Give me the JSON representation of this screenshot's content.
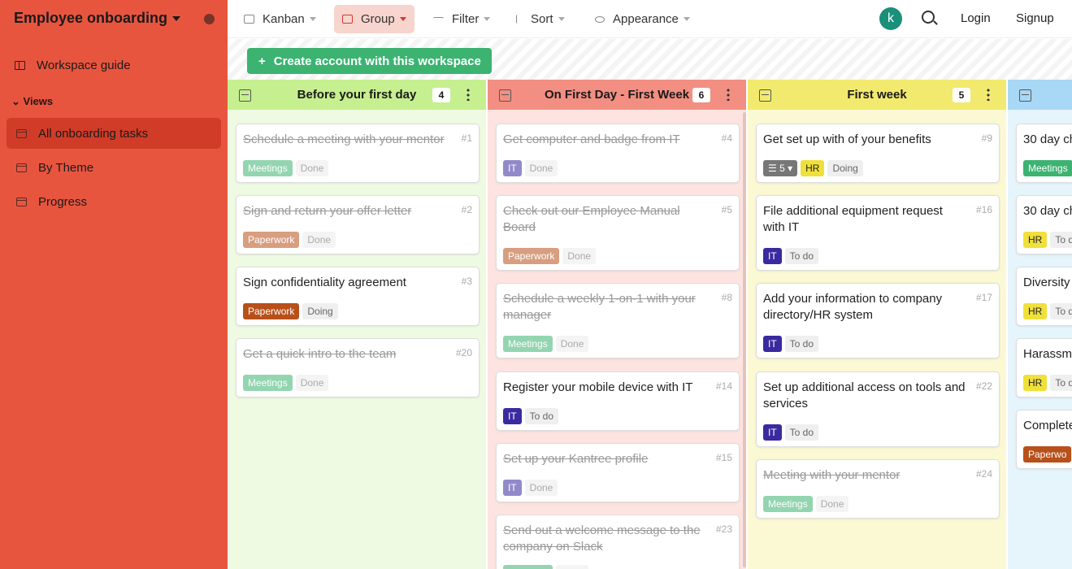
{
  "sidebar": {
    "workspace_title": "Employee onboarding",
    "guide_label": "Workspace guide",
    "views_label": "Views",
    "items": [
      {
        "label": "All onboarding tasks",
        "active": true
      },
      {
        "label": "By Theme",
        "active": false
      },
      {
        "label": "Progress",
        "active": false
      }
    ]
  },
  "toolbar": {
    "kanban": "Kanban",
    "group": "Group",
    "filter": "Filter",
    "sort": "Sort",
    "appearance": "Appearance",
    "avatar_letter": "k",
    "login": "Login",
    "signup": "Signup"
  },
  "banner": {
    "create_label": "Create account with this workspace"
  },
  "columns": [
    {
      "title": "Before your first day",
      "count": "4",
      "color": "#c6ef8f",
      "bg": "#eefbe2",
      "cards": [
        {
          "title": "Schedule a meeting with your mentor",
          "num": "#1",
          "done": true,
          "tag": "Meetings",
          "status": "Done"
        },
        {
          "title": "Sign and return your offer letter",
          "num": "#2",
          "done": true,
          "tag": "Paperwork",
          "status": "Done"
        },
        {
          "title": "Sign confidentiality agreement",
          "num": "#3",
          "done": false,
          "tag": "Paperwork",
          "status": "Doing"
        },
        {
          "title": "Get a quick intro to the team",
          "num": "#20",
          "done": true,
          "tag": "Meetings",
          "status": "Done"
        }
      ]
    },
    {
      "title": "On First Day - First Week",
      "count": "6",
      "color": "#f28f82",
      "bg": "#fde4e0",
      "cards": [
        {
          "title": "Get computer and badge from IT",
          "num": "#4",
          "done": true,
          "tag": "IT",
          "status": "Done"
        },
        {
          "title": "Check out our Employee Manual Board",
          "num": "#5",
          "done": true,
          "tag": "Paperwork",
          "status": "Done"
        },
        {
          "title": "Schedule a weekly 1-on-1 with your manager",
          "num": "#8",
          "done": true,
          "tag": "Meetings",
          "status": "Done"
        },
        {
          "title": "Register your mobile device with IT",
          "num": "#14",
          "done": false,
          "tag": "IT",
          "status": "To do"
        },
        {
          "title": "Set up your Kantree profile",
          "num": "#15",
          "done": true,
          "tag": "IT",
          "status": "Done"
        },
        {
          "title": "Send out a welcome message to the company on Slack",
          "num": "#23",
          "done": true,
          "tag": "Meetings",
          "status": "Done"
        }
      ]
    },
    {
      "title": "First week",
      "count": "5",
      "color": "#f2ea6e",
      "bg": "#fbf8d4",
      "cards": [
        {
          "title": "Get set up with of your benefits",
          "num": "#9",
          "done": false,
          "sub": "5",
          "tag": "HR",
          "status": "Doing"
        },
        {
          "title": "File additional equipment request with IT",
          "num": "#16",
          "done": false,
          "tag": "IT",
          "status": "To do"
        },
        {
          "title": "Add your information to company directory/HR system",
          "num": "#17",
          "done": false,
          "tag": "IT",
          "status": "To do"
        },
        {
          "title": "Set up additional access on tools and services",
          "num": "#22",
          "done": false,
          "tag": "IT",
          "status": "To do"
        },
        {
          "title": "Meeting with your mentor",
          "num": "#24",
          "done": true,
          "tag": "Meetings",
          "status": "Done"
        }
      ]
    },
    {
      "title": "",
      "count": "",
      "color": "#a8d8f5",
      "bg": "#e6f4fc",
      "cards": [
        {
          "title": "30 day ch",
          "num": "",
          "done": false,
          "tag": "Meetings",
          "status": ""
        },
        {
          "title": "30 day ch",
          "num": "",
          "done": false,
          "tag": "HR",
          "status": "To do"
        },
        {
          "title": "Diversity",
          "num": "",
          "done": false,
          "tag": "HR",
          "status": "To do"
        },
        {
          "title": "Harassme",
          "num": "",
          "done": false,
          "tag": "HR",
          "status": "To do"
        },
        {
          "title": "Complete",
          "num": "",
          "done": false,
          "tag": "Paperwo",
          "status": ""
        }
      ]
    }
  ],
  "colors": {
    "sidebar": "#e8553f",
    "active_item": "#d03c28",
    "create_button": "#3cb371",
    "avatar": "#1a8f7a"
  },
  "icons": [
    "globe-icon",
    "book-icon",
    "table-icon",
    "kanban-icon",
    "group-icon",
    "filter-icon",
    "sort-icon",
    "eye-icon",
    "search-icon",
    "plus-icon",
    "more-icon",
    "checkbox-icon"
  ]
}
